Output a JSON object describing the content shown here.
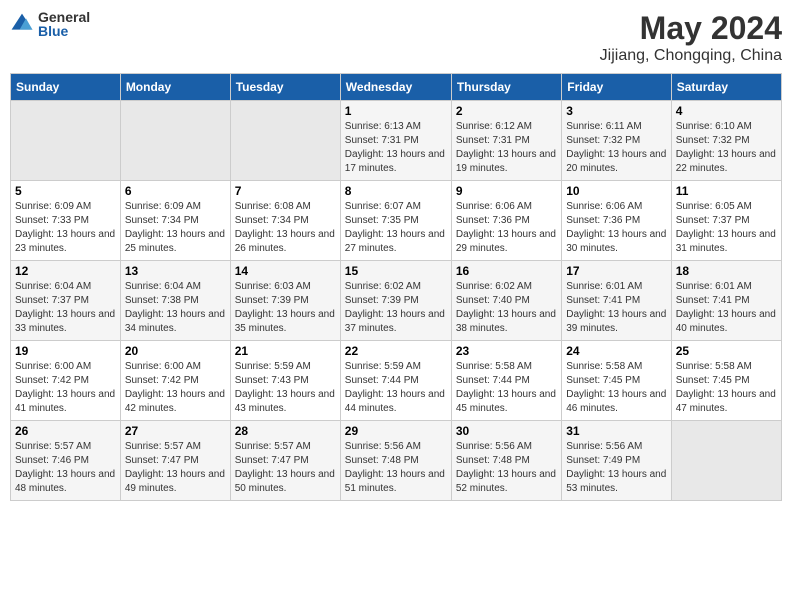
{
  "logo": {
    "general": "General",
    "blue": "Blue"
  },
  "title": {
    "month_year": "May 2024",
    "location": "Jijiang, Chongqing, China"
  },
  "headers": [
    "Sunday",
    "Monday",
    "Tuesday",
    "Wednesday",
    "Thursday",
    "Friday",
    "Saturday"
  ],
  "weeks": [
    [
      {
        "day": "",
        "sunrise": "",
        "sunset": "",
        "daylight": "",
        "empty": true
      },
      {
        "day": "",
        "sunrise": "",
        "sunset": "",
        "daylight": "",
        "empty": true
      },
      {
        "day": "",
        "sunrise": "",
        "sunset": "",
        "daylight": "",
        "empty": true
      },
      {
        "day": "1",
        "sunrise": "Sunrise: 6:13 AM",
        "sunset": "Sunset: 7:31 PM",
        "daylight": "Daylight: 13 hours and 17 minutes."
      },
      {
        "day": "2",
        "sunrise": "Sunrise: 6:12 AM",
        "sunset": "Sunset: 7:31 PM",
        "daylight": "Daylight: 13 hours and 19 minutes."
      },
      {
        "day": "3",
        "sunrise": "Sunrise: 6:11 AM",
        "sunset": "Sunset: 7:32 PM",
        "daylight": "Daylight: 13 hours and 20 minutes."
      },
      {
        "day": "4",
        "sunrise": "Sunrise: 6:10 AM",
        "sunset": "Sunset: 7:32 PM",
        "daylight": "Daylight: 13 hours and 22 minutes."
      }
    ],
    [
      {
        "day": "5",
        "sunrise": "Sunrise: 6:09 AM",
        "sunset": "Sunset: 7:33 PM",
        "daylight": "Daylight: 13 hours and 23 minutes."
      },
      {
        "day": "6",
        "sunrise": "Sunrise: 6:09 AM",
        "sunset": "Sunset: 7:34 PM",
        "daylight": "Daylight: 13 hours and 25 minutes."
      },
      {
        "day": "7",
        "sunrise": "Sunrise: 6:08 AM",
        "sunset": "Sunset: 7:34 PM",
        "daylight": "Daylight: 13 hours and 26 minutes."
      },
      {
        "day": "8",
        "sunrise": "Sunrise: 6:07 AM",
        "sunset": "Sunset: 7:35 PM",
        "daylight": "Daylight: 13 hours and 27 minutes."
      },
      {
        "day": "9",
        "sunrise": "Sunrise: 6:06 AM",
        "sunset": "Sunset: 7:36 PM",
        "daylight": "Daylight: 13 hours and 29 minutes."
      },
      {
        "day": "10",
        "sunrise": "Sunrise: 6:06 AM",
        "sunset": "Sunset: 7:36 PM",
        "daylight": "Daylight: 13 hours and 30 minutes."
      },
      {
        "day": "11",
        "sunrise": "Sunrise: 6:05 AM",
        "sunset": "Sunset: 7:37 PM",
        "daylight": "Daylight: 13 hours and 31 minutes."
      }
    ],
    [
      {
        "day": "12",
        "sunrise": "Sunrise: 6:04 AM",
        "sunset": "Sunset: 7:37 PM",
        "daylight": "Daylight: 13 hours and 33 minutes."
      },
      {
        "day": "13",
        "sunrise": "Sunrise: 6:04 AM",
        "sunset": "Sunset: 7:38 PM",
        "daylight": "Daylight: 13 hours and 34 minutes."
      },
      {
        "day": "14",
        "sunrise": "Sunrise: 6:03 AM",
        "sunset": "Sunset: 7:39 PM",
        "daylight": "Daylight: 13 hours and 35 minutes."
      },
      {
        "day": "15",
        "sunrise": "Sunrise: 6:02 AM",
        "sunset": "Sunset: 7:39 PM",
        "daylight": "Daylight: 13 hours and 37 minutes."
      },
      {
        "day": "16",
        "sunrise": "Sunrise: 6:02 AM",
        "sunset": "Sunset: 7:40 PM",
        "daylight": "Daylight: 13 hours and 38 minutes."
      },
      {
        "day": "17",
        "sunrise": "Sunrise: 6:01 AM",
        "sunset": "Sunset: 7:41 PM",
        "daylight": "Daylight: 13 hours and 39 minutes."
      },
      {
        "day": "18",
        "sunrise": "Sunrise: 6:01 AM",
        "sunset": "Sunset: 7:41 PM",
        "daylight": "Daylight: 13 hours and 40 minutes."
      }
    ],
    [
      {
        "day": "19",
        "sunrise": "Sunrise: 6:00 AM",
        "sunset": "Sunset: 7:42 PM",
        "daylight": "Daylight: 13 hours and 41 minutes."
      },
      {
        "day": "20",
        "sunrise": "Sunrise: 6:00 AM",
        "sunset": "Sunset: 7:42 PM",
        "daylight": "Daylight: 13 hours and 42 minutes."
      },
      {
        "day": "21",
        "sunrise": "Sunrise: 5:59 AM",
        "sunset": "Sunset: 7:43 PM",
        "daylight": "Daylight: 13 hours and 43 minutes."
      },
      {
        "day": "22",
        "sunrise": "Sunrise: 5:59 AM",
        "sunset": "Sunset: 7:44 PM",
        "daylight": "Daylight: 13 hours and 44 minutes."
      },
      {
        "day": "23",
        "sunrise": "Sunrise: 5:58 AM",
        "sunset": "Sunset: 7:44 PM",
        "daylight": "Daylight: 13 hours and 45 minutes."
      },
      {
        "day": "24",
        "sunrise": "Sunrise: 5:58 AM",
        "sunset": "Sunset: 7:45 PM",
        "daylight": "Daylight: 13 hours and 46 minutes."
      },
      {
        "day": "25",
        "sunrise": "Sunrise: 5:58 AM",
        "sunset": "Sunset: 7:45 PM",
        "daylight": "Daylight: 13 hours and 47 minutes."
      }
    ],
    [
      {
        "day": "26",
        "sunrise": "Sunrise: 5:57 AM",
        "sunset": "Sunset: 7:46 PM",
        "daylight": "Daylight: 13 hours and 48 minutes."
      },
      {
        "day": "27",
        "sunrise": "Sunrise: 5:57 AM",
        "sunset": "Sunset: 7:47 PM",
        "daylight": "Daylight: 13 hours and 49 minutes."
      },
      {
        "day": "28",
        "sunrise": "Sunrise: 5:57 AM",
        "sunset": "Sunset: 7:47 PM",
        "daylight": "Daylight: 13 hours and 50 minutes."
      },
      {
        "day": "29",
        "sunrise": "Sunrise: 5:56 AM",
        "sunset": "Sunset: 7:48 PM",
        "daylight": "Daylight: 13 hours and 51 minutes."
      },
      {
        "day": "30",
        "sunrise": "Sunrise: 5:56 AM",
        "sunset": "Sunset: 7:48 PM",
        "daylight": "Daylight: 13 hours and 52 minutes."
      },
      {
        "day": "31",
        "sunrise": "Sunrise: 5:56 AM",
        "sunset": "Sunset: 7:49 PM",
        "daylight": "Daylight: 13 hours and 53 minutes."
      },
      {
        "day": "",
        "sunrise": "",
        "sunset": "",
        "daylight": "",
        "empty": true
      }
    ]
  ]
}
